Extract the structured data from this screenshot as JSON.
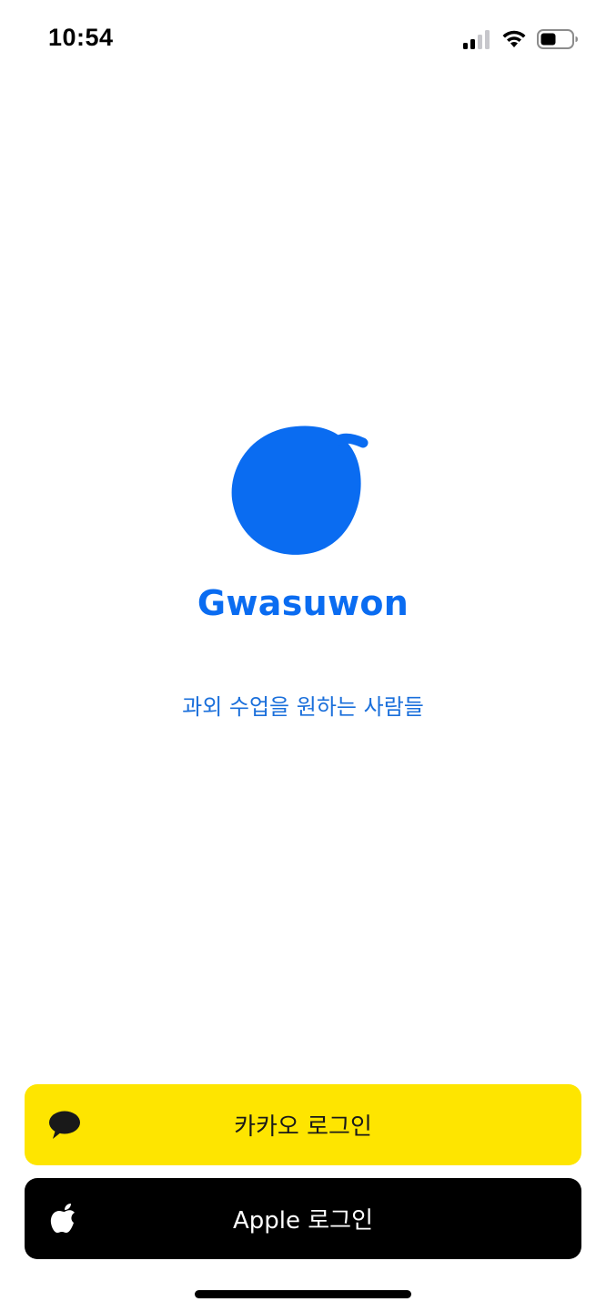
{
  "status_bar": {
    "time": "10:54",
    "icons": [
      "signal-icon",
      "wifi-icon",
      "battery-icon"
    ]
  },
  "branding": {
    "app_name": "Gwasuwon",
    "tagline": "과외 수업을 원하는 사람들",
    "logo_icon": "peach-icon",
    "brand_color": "#0a6cf1"
  },
  "login": {
    "kakao_label": "카카오 로그인",
    "kakao_icon": "speech-bubble-icon",
    "kakao_color": "#fee500",
    "apple_label": "Apple 로그인",
    "apple_icon": "apple-icon",
    "apple_color": "#000000"
  }
}
